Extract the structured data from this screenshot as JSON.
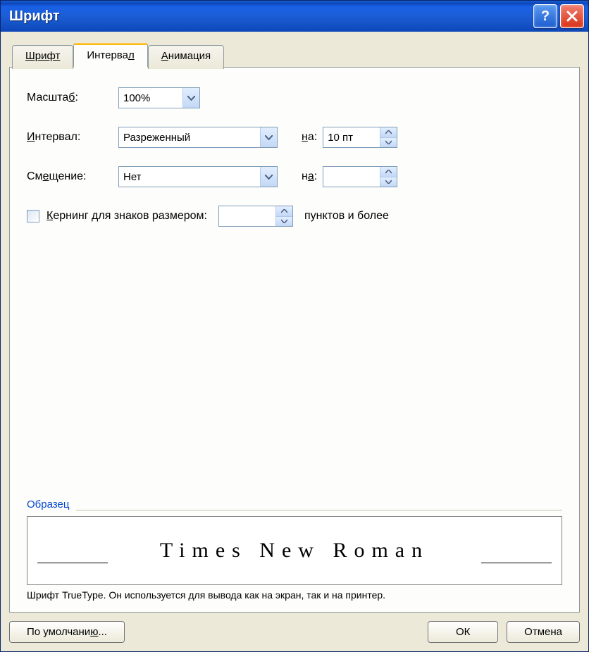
{
  "window": {
    "title": "Шрифт"
  },
  "tabs": {
    "font": "Шрифт",
    "interval": "Интервал",
    "animation": "Анимация"
  },
  "form": {
    "scale_label_pre": "Масшта",
    "scale_label_u": "б",
    "scale_label_post": ":",
    "scale_value": "100%",
    "spacing_label_pre": "",
    "spacing_label_u": "И",
    "spacing_label_post": "нтервал:",
    "spacing_value": "Разреженный",
    "spacing_by_label_u": "н",
    "spacing_by_label_post": "а:",
    "spacing_by_value": "10 пт",
    "position_label_pre": "См",
    "position_label_u": "е",
    "position_label_post": "щение:",
    "position_value": "Нет",
    "position_by_label_pre": "н",
    "position_by_label_u": "а",
    "position_by_label_post": ":",
    "position_by_value": "",
    "kerning_label_u": "К",
    "kerning_label_post": "ернинг для знаков размером:",
    "kerning_value": "",
    "kerning_suffix": "пунктов и более"
  },
  "preview": {
    "section_label": "Образец",
    "text": "Times New Roman",
    "hint": "Шрифт TrueType. Он используется для вывода как на экран, так и на принтер."
  },
  "buttons": {
    "default_pre": "По умолчани",
    "default_u": "ю",
    "default_post": "...",
    "ok": "ОК",
    "cancel": "Отмена"
  }
}
